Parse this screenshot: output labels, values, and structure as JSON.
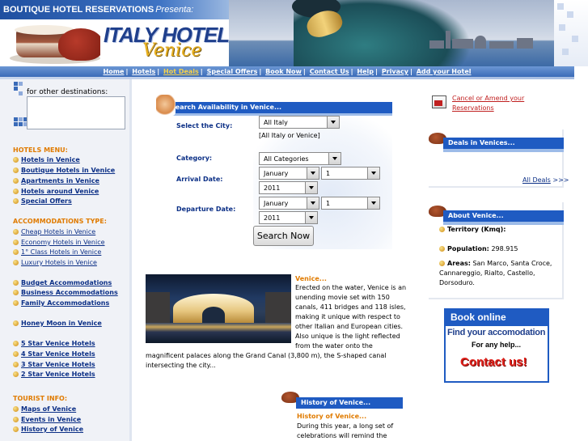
{
  "header": {
    "brand": "BOUTIQUE HOTEL RESERVATIONS",
    "presenta": "Presenta:",
    "logo_main": "ITALY HOTELS",
    "logo_sub": "Venice"
  },
  "nav": {
    "items": [
      "Home",
      "Hotels",
      "Hot Deals",
      "Special Offers",
      "Book Now",
      "Contact Us",
      "Help",
      "Privacy",
      "Add your Hotel"
    ],
    "separator": "|"
  },
  "sidebar": {
    "destinations_label": "for other destinations:",
    "hotels_menu_title": "HOTELS MENU:",
    "hotels_menu": [
      "Hotels in Venice",
      "Boutique Hotels in Venice",
      "Apartments in Venice",
      "Hotels around Venice",
      "Special Offers"
    ],
    "accommodations_title": "ACCOMMODATIONS TYPE:",
    "accommodations": [
      "Cheap Hotels in Venice",
      "Economy Hotels in Venice",
      "1° Class Hotels in Venice",
      "Luxury Hotels in Venice"
    ],
    "budget": [
      "Budget Accommodations",
      "Business Accommodations",
      "Family Accommodations"
    ],
    "honeymoon": [
      "Honey Moon in Venice"
    ],
    "stars": [
      "5 Star Venice Hotels",
      "4 Star Venice Hotels",
      "3 Star Venice Hotels",
      "2 Star Venice Hotels"
    ],
    "tourist_title": "TOURIST INFO:",
    "tourist": [
      "Maps of Venice",
      "Events in Venice",
      "History of Venice"
    ]
  },
  "search": {
    "header": "Search Availability in Venice...",
    "city_label": "Select the City:",
    "city_value": "All Italy",
    "city_hint": "[All Italy or Venice]",
    "category_label": "Category:",
    "category_value": "All Categories",
    "arrival_label": "Arrival Date:",
    "arrival_month": "January",
    "arrival_day": "1",
    "arrival_year": "2011",
    "departure_label": "Departure Date:",
    "departure_month": "January",
    "departure_day": "1",
    "departure_year": "2011",
    "button": "Search Now"
  },
  "article": {
    "title": "Venice...",
    "lines": [
      "Erected on the water, Venice is an",
      "unending movie set with 150",
      "canals, 411 bridges and 118 isles,",
      "making it unique with respect to",
      "other Italian and European cities.",
      "Also unique is the light reflected",
      "from the water onto the",
      "magnificent palaces along the Grand Canal (3,800 m), the S-shaped canal",
      "intersecting the city..."
    ]
  },
  "history": {
    "header": "History of Venice...",
    "title": "History of Venice...",
    "lines": [
      "During this year, a long set of",
      "celebrations will remind the"
    ]
  },
  "right": {
    "cancel_line1": "Cancel or Amend your",
    "cancel_line2": "Reservations",
    "deals_header": "Deals in Venices...",
    "all_deals": "All Deals",
    "all_deals_arrows": ">>>",
    "about_header": "About Venice...",
    "territory_label": "Territory (Kmq):",
    "population_label": "Population:",
    "population_value": "298.915",
    "areas_label": "Areas:",
    "areas_line1": "San Marco, Santa Croce,",
    "areas_line2": "Cannareggio, Rialto, Castello,",
    "areas_line3": "Dorsoduro."
  },
  "banner": {
    "book_online": "Book online",
    "find": "Find your accomodation",
    "help": "For any help...",
    "contact": "Contact us!"
  },
  "colors": {
    "accent_blue": "#1f5bc2",
    "orange_title": "#e07b00",
    "link_blue": "#0b2f86",
    "red_link": "#c02020"
  }
}
